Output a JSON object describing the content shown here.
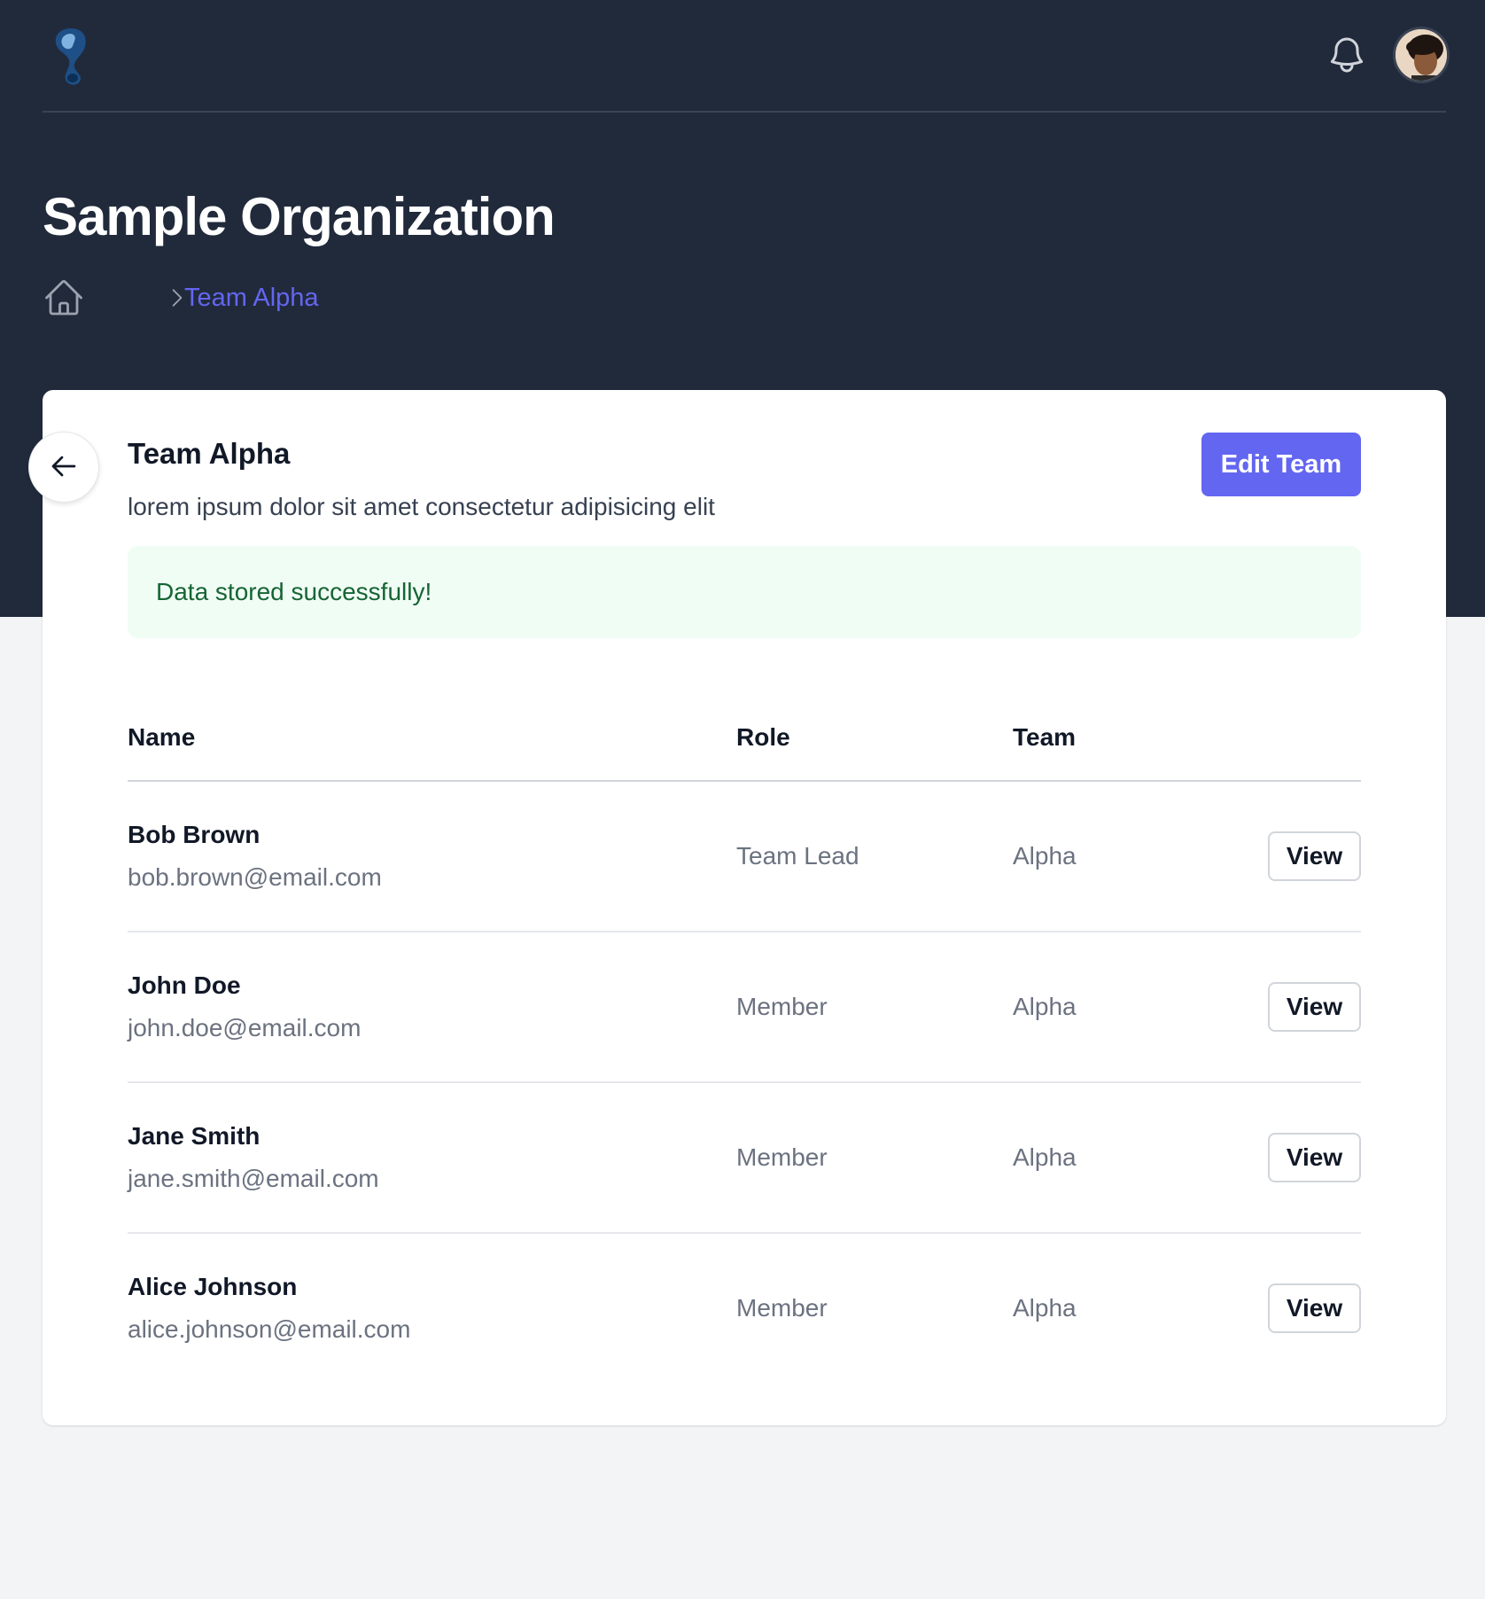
{
  "header": {
    "logo_icon": "logo-icon",
    "notifications_icon": "bell-icon",
    "avatar_icon": "user-avatar"
  },
  "page": {
    "title": "Sample Organization"
  },
  "breadcrumb": {
    "home_icon": "home-icon",
    "separator_icon": "chevron-right-icon",
    "current": "Team Alpha"
  },
  "team": {
    "name": "Team Alpha",
    "description": "lorem ipsum dolor sit amet consectetur adipisicing elit",
    "edit_label": "Edit Team",
    "back_icon": "arrow-left-icon"
  },
  "alert": {
    "message": "Data stored successfully!"
  },
  "table": {
    "columns": [
      "Name",
      "Role",
      "Team"
    ],
    "rows": [
      {
        "name": "Bob Brown",
        "email": "bob.brown@email.com",
        "role": "Team Lead",
        "team": "Alpha",
        "action": "View"
      },
      {
        "name": "John Doe",
        "email": "john.doe@email.com",
        "role": "Member",
        "team": "Alpha",
        "action": "View"
      },
      {
        "name": "Jane Smith",
        "email": "jane.smith@email.com",
        "role": "Member",
        "team": "Alpha",
        "action": "View"
      },
      {
        "name": "Alice Johnson",
        "email": "alice.johnson@email.com",
        "role": "Member",
        "team": "Alpha",
        "action": "View"
      }
    ]
  },
  "colors": {
    "header_bg": "#212a3b",
    "accent": "#6366f1",
    "success_bg": "#f0fdf4",
    "success_text": "#166534",
    "page_bg": "#f3f4f6"
  }
}
